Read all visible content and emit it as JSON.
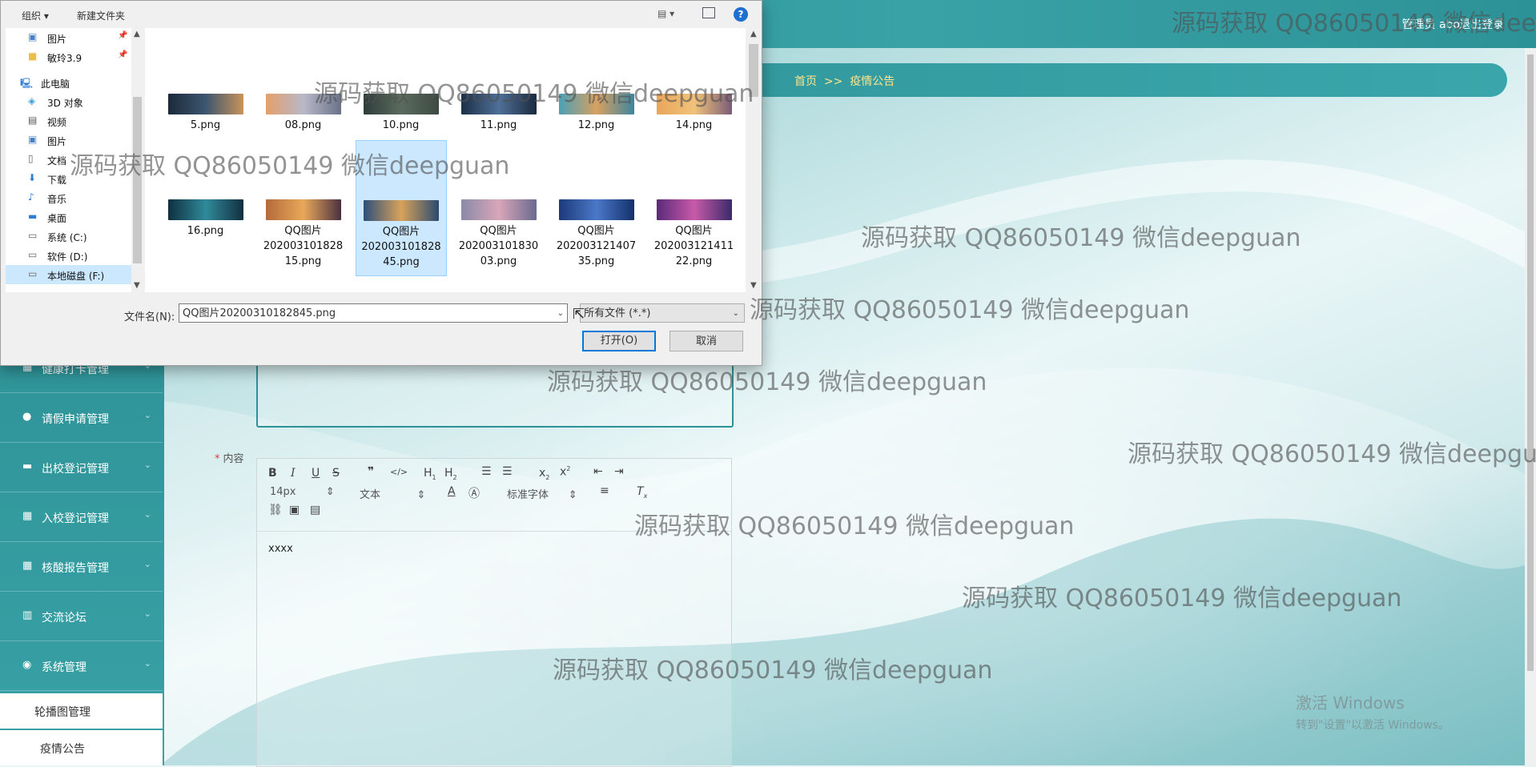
{
  "app": {
    "topbar": {
      "user": "管理员 abo",
      "logout": "退出登录"
    },
    "breadcrumb": {
      "home": "首页",
      "sep": ">>",
      "current": "疫情公告"
    },
    "sidebar": {
      "items": [
        {
          "label": "健康打卡管理",
          "icon": "grid-icon"
        },
        {
          "label": "请假申请管理",
          "icon": "user-icon"
        },
        {
          "label": "出校登记管理",
          "icon": "chat-icon"
        },
        {
          "label": "入校登记管理",
          "icon": "grid-icon"
        },
        {
          "label": "核酸报告管理",
          "icon": "grid-icon"
        },
        {
          "label": "交流论坛",
          "icon": "book-icon"
        },
        {
          "label": "系统管理",
          "icon": "pin-icon"
        }
      ],
      "subitems": [
        {
          "label": "轮播图管理"
        },
        {
          "label": "疫情公告"
        }
      ]
    },
    "form": {
      "content_label": "内容",
      "required_mark": "*",
      "editor": {
        "font_size": "14px",
        "text_type": "文本",
        "font_family": "标准字体",
        "body": "xxxx"
      }
    },
    "activate_windows": {
      "line1": "激活 Windows",
      "line2": "转到\"设置\"以激活 Windows。"
    }
  },
  "dialog": {
    "toolbar": {
      "organize": "组织 ▾",
      "new_folder": "新建文件夹",
      "help": "?"
    },
    "nav": [
      {
        "label": "图片",
        "icon": "pictures-icon",
        "pinned": true
      },
      {
        "label": "敏玲3.9",
        "icon": "folder-icon",
        "pinned": true
      },
      {
        "label": "此电脑",
        "icon": "computer-icon"
      },
      {
        "label": "3D 对象",
        "icon": "cube-icon"
      },
      {
        "label": "视频",
        "icon": "video-icon"
      },
      {
        "label": "图片",
        "icon": "pictures-icon"
      },
      {
        "label": "文档",
        "icon": "document-icon"
      },
      {
        "label": "下载",
        "icon": "download-icon"
      },
      {
        "label": "音乐",
        "icon": "music-icon"
      },
      {
        "label": "桌面",
        "icon": "desktop-icon"
      },
      {
        "label": "系统 (C:)",
        "icon": "drive-icon"
      },
      {
        "label": "软件 (D:)",
        "icon": "drive-icon"
      },
      {
        "label": "本地磁盘 (F:)",
        "icon": "drive-icon",
        "active": true
      }
    ],
    "files_row1": [
      {
        "name": "5.png"
      },
      {
        "name": "08.png"
      },
      {
        "name": "10.png"
      },
      {
        "name": "11.png"
      },
      {
        "name": "12.png"
      },
      {
        "name": "14.png"
      }
    ],
    "files_row2": [
      {
        "name": "16.png"
      },
      {
        "line1": "QQ图片",
        "line2": "202003101828",
        "line3": "15.png"
      },
      {
        "line1": "QQ图片",
        "line2": "202003101828",
        "line3": "45.png",
        "selected": true
      },
      {
        "line1": "QQ图片",
        "line2": "202003101830",
        "line3": "03.png"
      },
      {
        "line1": "QQ图片",
        "line2": "202003121407",
        "line3": "35.png"
      },
      {
        "line1": "QQ图片",
        "line2": "202003121411",
        "line3": "22.png"
      }
    ],
    "filename_label": "文件名(N):",
    "filename_value": "QQ图片20200310182845.png",
    "filetype_value": "所有文件 (*.*)",
    "open_button": "打开(O)",
    "cancel_button": "取消"
  },
  "watermark": "源码获取 QQ86050149 微信deepguan"
}
